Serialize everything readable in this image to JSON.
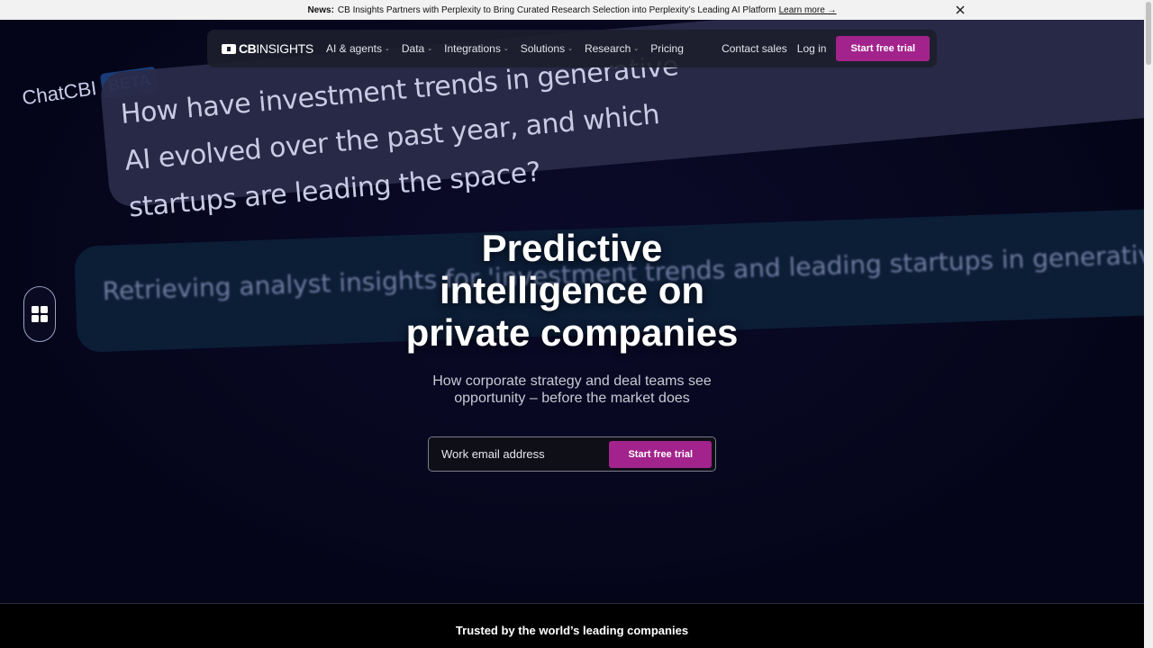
{
  "news": {
    "label": "News:",
    "text": "CB Insights Partners with Perplexity to Bring Curated Research Selection into Perplexity’s Leading AI Platform",
    "link": "Learn more →",
    "close_icon": "close-icon"
  },
  "nav": {
    "brand_cb": "CB",
    "brand_insights": "INSIGHTS",
    "items": [
      {
        "label": "AI & agents",
        "has_menu": true
      },
      {
        "label": "Data",
        "has_menu": true
      },
      {
        "label": "Integrations",
        "has_menu": true
      },
      {
        "label": "Solutions",
        "has_menu": true
      },
      {
        "label": "Research",
        "has_menu": true
      },
      {
        "label": "Pricing",
        "has_menu": false
      }
    ],
    "contact": "Contact sales",
    "login": "Log in",
    "cta": "Start free trial"
  },
  "background": {
    "chatcbi": "ChatCBI",
    "beta": "BETA",
    "prompt": "How have investment trends in generative AI evolved over the past year, and which startups are leading the space?",
    "retrieving": "Retrieving analyst insights for 'investment trends and leading startups in generative AI'"
  },
  "hero": {
    "headline": [
      "Predictive",
      "intelligence on",
      "private companies"
    ],
    "subhead": [
      "How corporate strategy and deal teams see",
      "opportunity – before the market does"
    ],
    "email_placeholder": "Work email address",
    "cta": "Start free trial"
  },
  "trusted": {
    "text": "Trusted by the world’s leading companies"
  },
  "colors": {
    "accent": "#a3238c",
    "background": "#05051a"
  }
}
